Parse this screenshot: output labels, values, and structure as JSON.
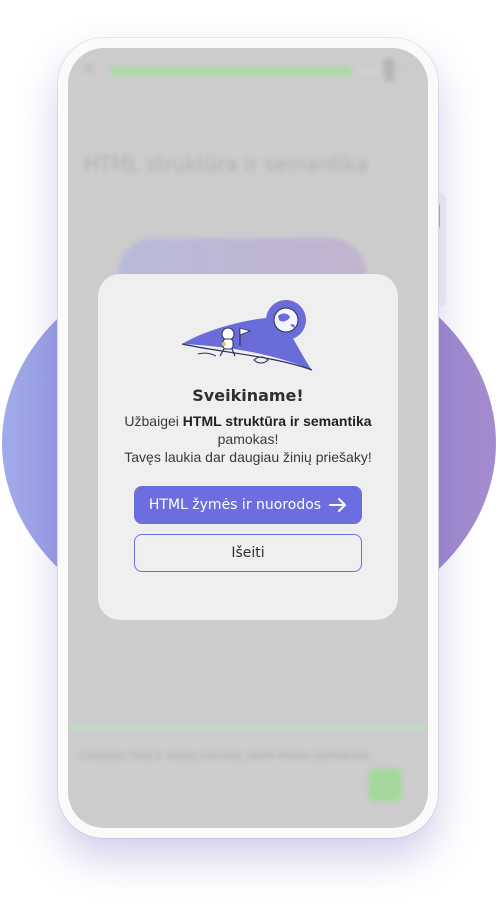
{
  "background_lesson": {
    "title": "HTML struktūra ir semantika",
    "progress": 0.9,
    "footer_text": "Daugiau žinių ir naujų nuorodų rasite kitose pamokose.",
    "close_icon": "close-icon",
    "profile_icon": "person-icon",
    "next_icon": "next-icon"
  },
  "dialog": {
    "title": "Sveikiname!",
    "message_prefix": "Užbaigei",
    "message_course": "HTML struktūra ir semantika",
    "message_suffix": "pamokas!",
    "message_line2": "Tavęs laukia dar daugiau žinių priešaky!",
    "primary_button": "HTML žymės ir nuorodos",
    "secondary_button": "Išeiti",
    "illustration": "astronaut-on-planet-illustration"
  },
  "colors": {
    "accent": "#6c6edf",
    "progress": "#a6dca0",
    "backdrop_gradient_start": "#a0aaea",
    "backdrop_gradient_end": "#a48bcd"
  }
}
